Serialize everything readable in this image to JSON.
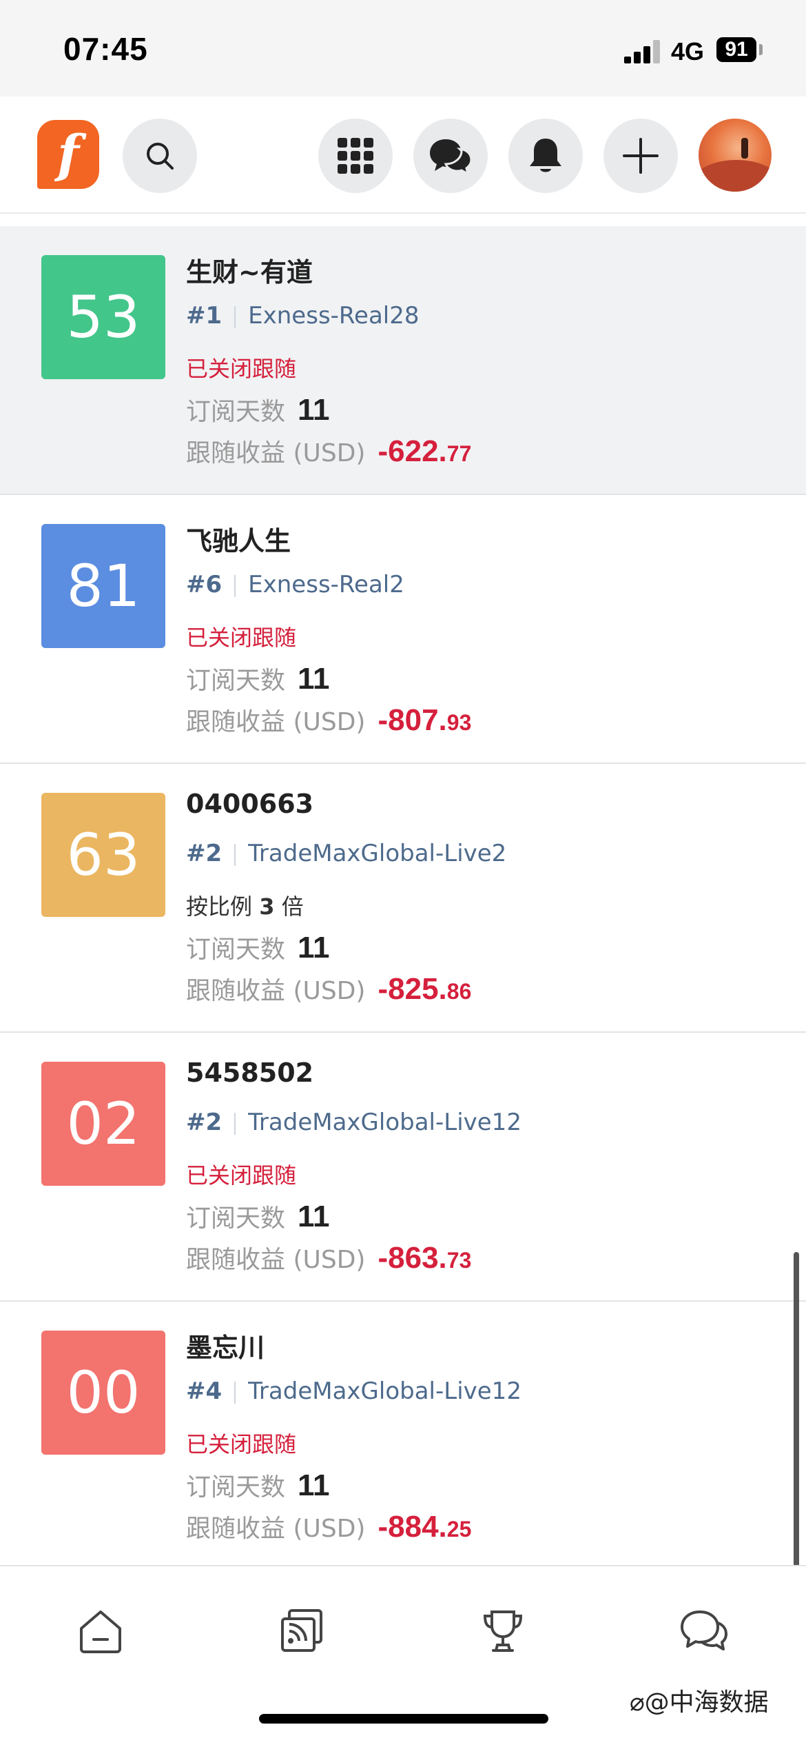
{
  "status_bar": {
    "time": "07:45",
    "network": "4G",
    "battery": "91"
  },
  "header": {
    "logo_letter": "f",
    "icons": [
      "search-icon",
      "grid-apps-icon",
      "chat-bubbles-icon",
      "bell-icon",
      "plus-icon"
    ]
  },
  "cards": [
    {
      "score": "53",
      "score_color": "#43c68a",
      "name": "生财~有道",
      "rank": "#1",
      "server": "Exness-Real28",
      "status": "已关闭跟随",
      "days_label": "订阅天数",
      "days": "11",
      "pnl_label": "跟随收益 (USD)",
      "pnl_int": "-622.",
      "pnl_dec": "77"
    },
    {
      "score": "81",
      "score_color": "#5b8de0",
      "name": "飞驰人生",
      "rank": "#6",
      "server": "Exness-Real2",
      "status": "已关闭跟随",
      "days_label": "订阅天数",
      "days": "11",
      "pnl_label": "跟随收益 (USD)",
      "pnl_int": "-807.",
      "pnl_dec": "93"
    },
    {
      "score": "63",
      "score_color": "#ebb661",
      "name": "0400663",
      "rank": "#2",
      "server": "TradeMaxGlobal-Live2",
      "status_prefix": "按比例",
      "status_value": "3",
      "status_suffix": "倍",
      "days_label": "订阅天数",
      "days": "11",
      "pnl_label": "跟随收益 (USD)",
      "pnl_int": "-825.",
      "pnl_dec": "86"
    },
    {
      "score": "02",
      "score_color": "#f3736e",
      "name": "5458502",
      "rank": "#2",
      "server": "TradeMaxGlobal-Live12",
      "status": "已关闭跟随",
      "days_label": "订阅天数",
      "days": "11",
      "pnl_label": "跟随收益 (USD)",
      "pnl_int": "-863.",
      "pnl_dec": "73"
    },
    {
      "score": "00",
      "score_color": "#f3736e",
      "name": "墨忘川",
      "rank": "#4",
      "server": "TradeMaxGlobal-Live12",
      "status": "已关闭跟随",
      "days_label": "订阅天数",
      "days": "11",
      "pnl_label": "跟随收益 (USD)",
      "pnl_int": "-884.",
      "pnl_dec": "25"
    }
  ],
  "tabbar": {
    "icons": [
      "home-icon",
      "feed-icon",
      "trophy-icon",
      "chat-icon"
    ]
  },
  "watermark": "⌀@中海数据"
}
